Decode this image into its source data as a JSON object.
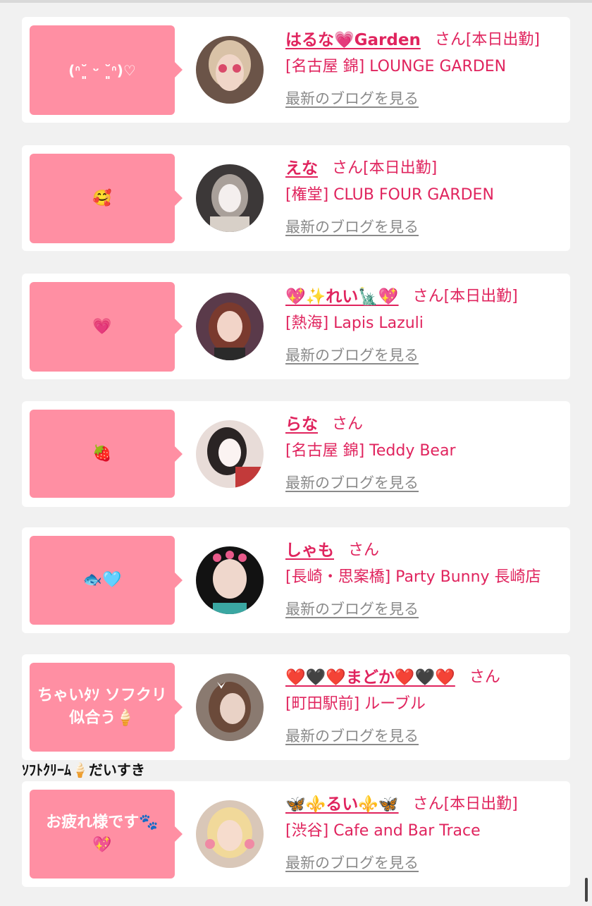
{
  "common": {
    "honorific": "さん",
    "blog_link": "最新のブログを見る"
  },
  "cards": [
    {
      "bubble": "(ᐢ˘͈ ᵕ ˘͈ᐢ)♡",
      "name": "はるな💗Garden",
      "status": "[本日出勤]",
      "shop": "[名古屋 錦] LOUNGE GARDEN"
    },
    {
      "bubble": "🥰",
      "name": "えな",
      "status": "[本日出勤]",
      "shop": "[権堂] CLUB FOUR GARDEN"
    },
    {
      "bubble": "💗",
      "name": "💖✨れい🗽💖",
      "status": "[本日出勤]",
      "shop": "[熱海] Lapis Lazuli"
    },
    {
      "bubble": "🍓",
      "name": "らな",
      "status": "",
      "shop": "[名古屋 錦] Teddy Bear"
    },
    {
      "bubble": "🐟🩵",
      "name": "しゃも",
      "status": "",
      "shop": "[長崎・思案橋] Party Bunny 長崎店"
    },
    {
      "bubble": "ちゃいﾀｿ ソフクリ\n似合う🍦",
      "name": "❤️🖤❤️まどか❤️🖤❤️",
      "status": "",
      "shop": "[町田駅前] ルーブル"
    },
    {
      "bubble": "お疲れ様です🐾\n💖",
      "name": "🦋⚜️るい⚜️🦋",
      "status": "[本日出勤]",
      "shop": "[渋谷] Cafe and Bar Trace"
    }
  ],
  "caption": "ｿﾌﾄｸﾘｰﾑ🍦だいすき",
  "colors": {
    "accent": "#e0245e",
    "bubble": "#ff8fa3",
    "link_gray": "#8a8a8a",
    "background": "#f1f1f1"
  }
}
